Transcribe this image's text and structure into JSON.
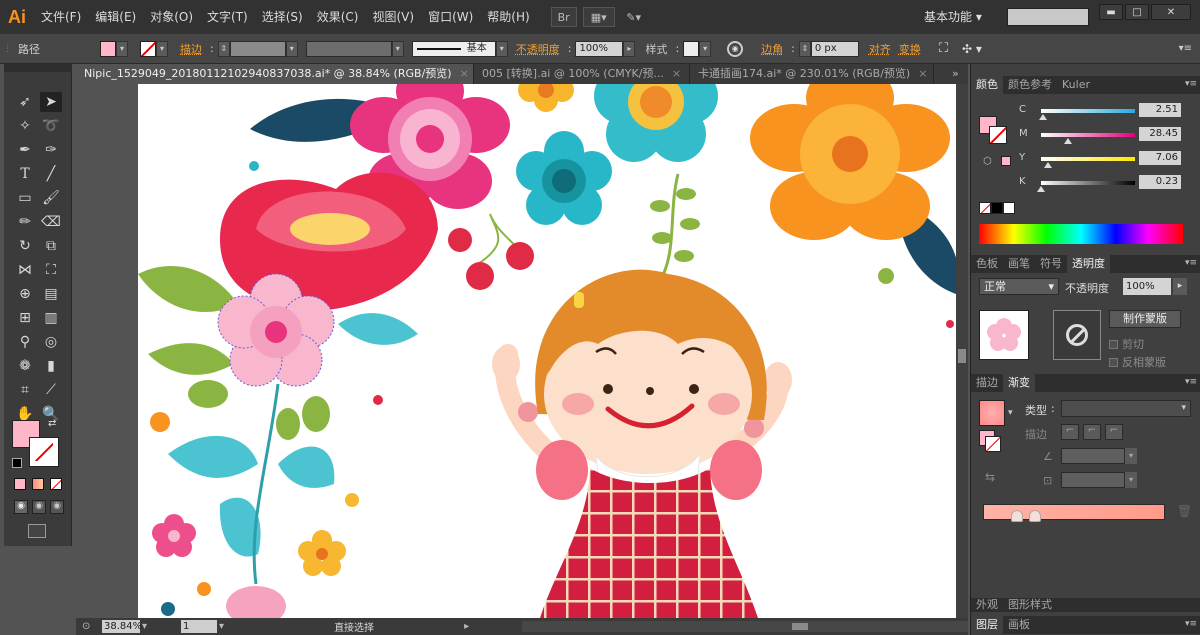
{
  "app": {
    "logo": "Ai",
    "menus": [
      "文件(F)",
      "编辑(E)",
      "对象(O)",
      "文字(T)",
      "选择(S)",
      "效果(C)",
      "视图(V)",
      "窗口(W)",
      "帮助(H)"
    ],
    "workspace": "基本功能",
    "search_placeholder": ""
  },
  "control_bar": {
    "selection_label": "路径",
    "fill_color": "#ffb6c8",
    "stroke_label": "描边",
    "stroke_style": "基本",
    "opacity_label": "不透明度",
    "opacity_value": "100%",
    "style_label": "样式",
    "corner_label": "边角",
    "corner_value": "0 px",
    "align_label": "对齐",
    "transform_label": "变换"
  },
  "tabs": [
    {
      "label": "Nipic_1529049_20180112102940837038.ai* @ 38.84% (RGB/预览)",
      "close": "×",
      "active": true
    },
    {
      "label": "005 [转换].ai @ 100% (CMYK/预...",
      "close": "×",
      "active": false
    },
    {
      "label": "卡通插画174.ai* @ 230.01% (RGB/预览)",
      "close": "×",
      "active": false
    }
  ],
  "status": {
    "zoom": "38.84%",
    "page": "1",
    "tool_name": "直接选择"
  },
  "color_panel": {
    "tabs": [
      "颜色",
      "颜色参考",
      "Kuler"
    ],
    "channels": [
      {
        "label": "C",
        "value": "2.51",
        "fraction": 0.025,
        "color": "#29a9e0"
      },
      {
        "label": "M",
        "value": "28.45",
        "fraction": 0.284,
        "color": "#e2007a"
      },
      {
        "label": "Y",
        "value": "7.06",
        "fraction": 0.07,
        "color": "#ffe600"
      },
      {
        "label": "K",
        "value": "0.23",
        "fraction": 0.002,
        "color": "#000000"
      }
    ]
  },
  "transparency_panel": {
    "tabs": [
      "色板",
      "画笔",
      "符号",
      "透明度"
    ],
    "blend_mode": "正常",
    "opacity_label": "不透明度",
    "opacity_value": "100%",
    "make_mask_button": "制作蒙版",
    "clip_label": "剪切",
    "invert_label": "反相蒙版"
  },
  "gradient_panel": {
    "tabs": [
      "描边",
      "渐变"
    ],
    "type_label": "类型",
    "stroke_label": "描边"
  },
  "layers_panel": {
    "tabs": [
      "图层",
      "画板"
    ],
    "hidden_tabs": [
      "外观",
      "图形样式"
    ]
  }
}
